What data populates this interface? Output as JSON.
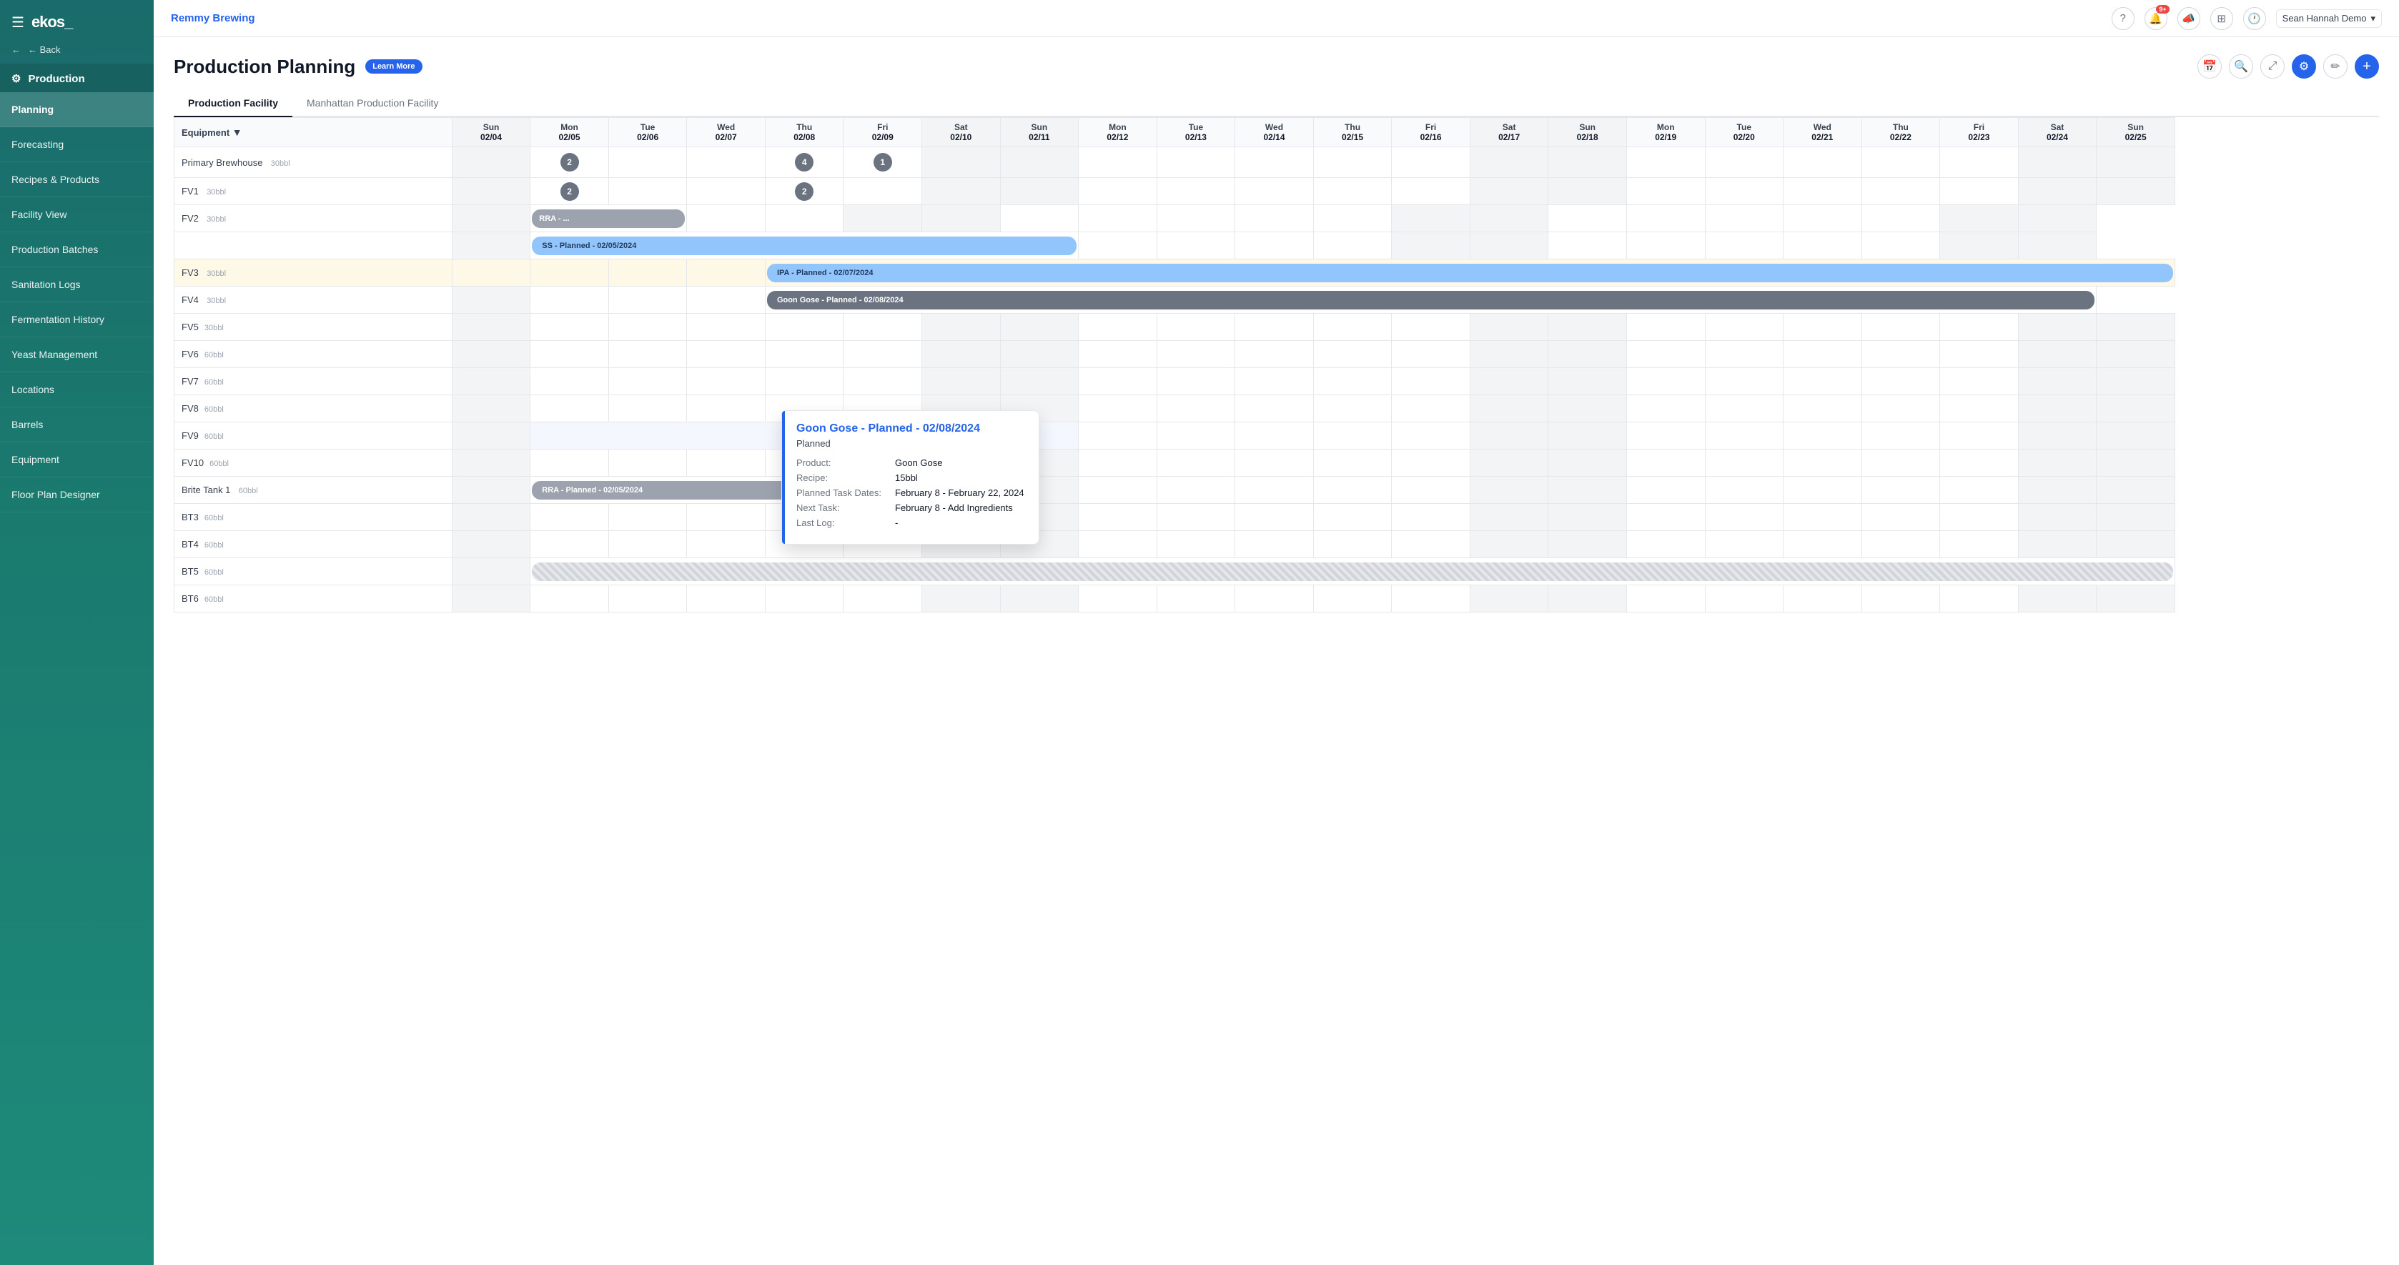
{
  "sidebar": {
    "logo": "ekos_",
    "brand_section": "Production",
    "back_label": "← Back",
    "items": [
      {
        "id": "planning",
        "label": "Planning",
        "active": true
      },
      {
        "id": "forecasting",
        "label": "Forecasting"
      },
      {
        "id": "recipes-products",
        "label": "Recipes & Products"
      },
      {
        "id": "facility-view",
        "label": "Facility View"
      },
      {
        "id": "production-batches",
        "label": "Production Batches"
      },
      {
        "id": "sanitation-logs",
        "label": "Sanitation Logs"
      },
      {
        "id": "fermentation-history",
        "label": "Fermentation History"
      },
      {
        "id": "yeast-management",
        "label": "Yeast Management"
      },
      {
        "id": "locations",
        "label": "Locations"
      },
      {
        "id": "barrels",
        "label": "Barrels"
      },
      {
        "id": "equipment",
        "label": "Equipment"
      },
      {
        "id": "floor-plan-designer",
        "label": "Floor Plan Designer"
      }
    ]
  },
  "topnav": {
    "brand": "Remmy Brewing",
    "notification_count": "9+",
    "user": "Sean Hannah Demo"
  },
  "page": {
    "title": "Production Planning",
    "learn_more": "Learn More"
  },
  "tabs": [
    {
      "id": "production-facility",
      "label": "Production Facility",
      "active": true
    },
    {
      "id": "manhattan",
      "label": "Manhattan Production Facility"
    }
  ],
  "calendar": {
    "columns": [
      {
        "dow": "Sun",
        "date": "02/04",
        "weekend": true
      },
      {
        "dow": "Mon",
        "date": "02/05",
        "weekend": false
      },
      {
        "dow": "Tue",
        "date": "02/06",
        "weekend": false
      },
      {
        "dow": "Wed",
        "date": "02/07",
        "weekend": false
      },
      {
        "dow": "Thu",
        "date": "02/08",
        "weekend": false
      },
      {
        "dow": "Fri",
        "date": "02/09",
        "weekend": false
      },
      {
        "dow": "Sat",
        "date": "02/10",
        "weekend": true
      },
      {
        "dow": "Sun",
        "date": "02/11",
        "weekend": true
      },
      {
        "dow": "Mon",
        "date": "02/12",
        "weekend": false
      },
      {
        "dow": "Tue",
        "date": "02/13",
        "weekend": false
      },
      {
        "dow": "Wed",
        "date": "02/14",
        "weekend": false
      },
      {
        "dow": "Thu",
        "date": "02/15",
        "weekend": false
      },
      {
        "dow": "Fri",
        "date": "02/16",
        "weekend": false
      },
      {
        "dow": "Sat",
        "date": "02/17",
        "weekend": true
      },
      {
        "dow": "Sun",
        "date": "02/18",
        "weekend": true
      },
      {
        "dow": "Mon",
        "date": "02/19",
        "weekend": false
      },
      {
        "dow": "Tue",
        "date": "02/20",
        "weekend": false
      },
      {
        "dow": "Wed",
        "date": "02/21",
        "weekend": false
      },
      {
        "dow": "Thu",
        "date": "02/22",
        "weekend": false
      },
      {
        "dow": "Fri",
        "date": "02/23",
        "weekend": false
      },
      {
        "dow": "Sat",
        "date": "02/24",
        "weekend": true
      },
      {
        "dow": "Sun",
        "date": "02/25",
        "weekend": true
      }
    ]
  },
  "equipment_rows": [
    {
      "name": "Primary Brewhouse",
      "size": "30bbl"
    },
    {
      "name": "FV1",
      "size": "30bbl"
    },
    {
      "name": "FV2",
      "size": "30bbl"
    },
    {
      "name": "FV3",
      "size": "30bbl"
    },
    {
      "name": "FV4",
      "size": "30bbl"
    },
    {
      "name": "FV5",
      "size": "30bbl"
    },
    {
      "name": "FV6",
      "size": "60bbl"
    },
    {
      "name": "FV7",
      "size": "60bbl"
    },
    {
      "name": "FV8",
      "size": "60bbl"
    },
    {
      "name": "FV9",
      "size": "60bbl"
    },
    {
      "name": "FV10",
      "size": "60bbl"
    },
    {
      "name": "Brite Tank 1",
      "size": "60bbl"
    },
    {
      "name": "BT3",
      "size": "60bbl"
    },
    {
      "name": "BT4",
      "size": "60bbl"
    },
    {
      "name": "BT5",
      "size": "60bbl"
    },
    {
      "name": "BT6",
      "size": "60bbl"
    }
  ],
  "tooltip": {
    "title": "Goon Gose - Planned - 02/08/2024",
    "status": "Planned",
    "product_label": "Product:",
    "product_value": "Goon Gose",
    "recipe_label": "Recipe:",
    "recipe_value": "15bbl",
    "task_dates_label": "Planned Task Dates:",
    "task_dates_value": "February 8 - February 22, 2024",
    "next_task_label": "Next Task:",
    "next_task_value": "February 8 - Add Ingredients",
    "last_log_label": "Last Log:",
    "last_log_value": "-"
  }
}
